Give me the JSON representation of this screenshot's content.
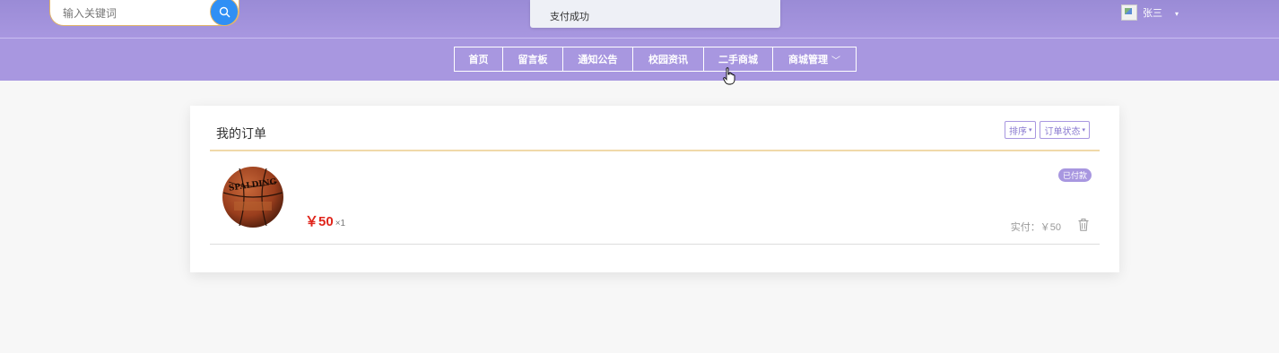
{
  "search": {
    "placeholder": "输入关键词",
    "icon": "search-icon"
  },
  "toast": {
    "message": "支付成功"
  },
  "user": {
    "name": "张三",
    "caret": "▾"
  },
  "nav": {
    "items": [
      {
        "label": "首页"
      },
      {
        "label": "留言板"
      },
      {
        "label": "通知公告"
      },
      {
        "label": "校园资讯"
      },
      {
        "label": "二手商城"
      },
      {
        "label": "商城管理",
        "chevron": "﹀"
      }
    ]
  },
  "orders": {
    "title": "我的订单",
    "sort_label": "排序",
    "status_filter_label": "订单状态",
    "items": [
      {
        "image": "basketball-image",
        "price": "￥50",
        "quantity": "×1",
        "status": "已付款",
        "paid_label": "实付：￥50",
        "delete_icon": "trash-icon"
      }
    ]
  },
  "colors": {
    "brand": "#a897e0",
    "search_button": "#2f8ff5",
    "price": "#e0261c",
    "divider": "#f0d9a9"
  }
}
